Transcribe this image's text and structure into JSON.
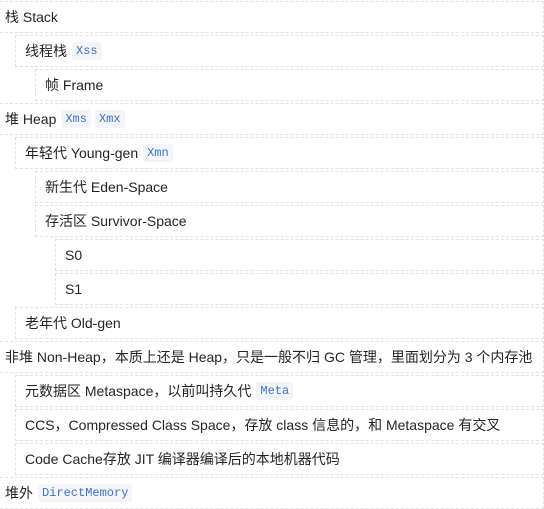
{
  "tree": {
    "rows": [
      {
        "level": 0,
        "text": "栈 Stack",
        "tags": []
      },
      {
        "level": 1,
        "text": "线程栈",
        "tags": [
          "Xss"
        ]
      },
      {
        "level": 2,
        "text": "帧 Frame",
        "tags": []
      },
      {
        "level": 0,
        "text": "堆 Heap",
        "tags": [
          "Xms",
          "Xmx"
        ]
      },
      {
        "level": 1,
        "text": "年轻代 Young-gen",
        "tags": [
          "Xmn"
        ]
      },
      {
        "level": 2,
        "text": "新生代 Eden-Space",
        "tags": []
      },
      {
        "level": 2,
        "text": "存活区 Survivor-Space",
        "tags": []
      },
      {
        "level": 3,
        "text": "S0",
        "tags": []
      },
      {
        "level": 3,
        "text": "S1",
        "tags": []
      },
      {
        "level": 1,
        "text": "老年代 Old-gen",
        "tags": []
      },
      {
        "level": 0,
        "text": "非堆 Non-Heap，本质上还是 Heap，只是一般不归 GC 管理，里面划分为 3 个内存池",
        "tags": []
      },
      {
        "level": 1,
        "text": "元数据区 Metaspace，以前叫持久代",
        "tags": [
          "Meta"
        ]
      },
      {
        "level": 1,
        "text": "CCS，Compressed Class Space，存放 class 信息的，和 Metaspace 有交叉",
        "tags": []
      },
      {
        "level": 1,
        "text": "Code Cache存放 JIT 编译器编译后的本地机器代码",
        "tags": []
      },
      {
        "level": 0,
        "text": "堆外",
        "tags": [
          "DirectMemory"
        ]
      }
    ]
  }
}
